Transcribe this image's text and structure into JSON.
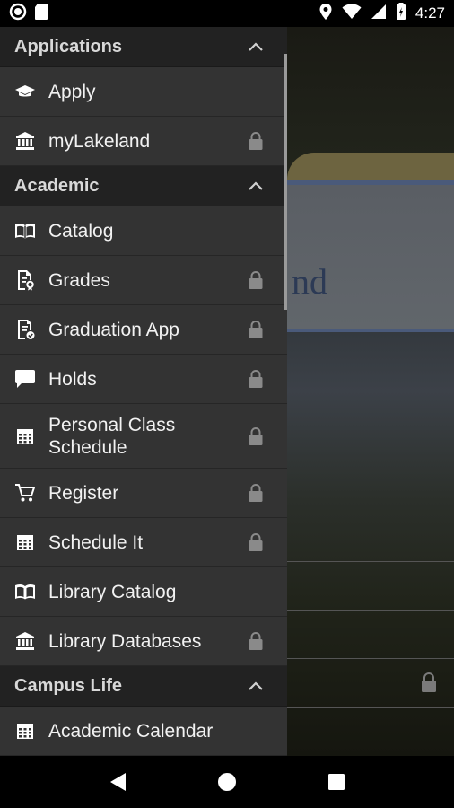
{
  "status_bar": {
    "time": "4:27",
    "icons": [
      "circle-notification-icon",
      "sd-card-icon",
      "location-icon",
      "wifi-icon",
      "signal-icon",
      "battery-icon"
    ]
  },
  "drawer": {
    "sections": [
      {
        "title": "Applications",
        "items": [
          {
            "label": "Apply",
            "icon": "graduation-cap-icon",
            "locked": false
          },
          {
            "label": "myLakeland",
            "icon": "bank-icon",
            "locked": true
          }
        ]
      },
      {
        "title": "Academic",
        "items": [
          {
            "label": "Catalog",
            "icon": "book-icon",
            "locked": false
          },
          {
            "label": "Grades",
            "icon": "grades-doc-icon",
            "locked": true
          },
          {
            "label": "Graduation App",
            "icon": "doc-check-icon",
            "locked": true
          },
          {
            "label": "Holds",
            "icon": "chat-bubble-icon",
            "locked": true
          },
          {
            "label": "Personal Class Schedule",
            "icon": "calendar-icon",
            "locked": true
          },
          {
            "label": "Register",
            "icon": "cart-icon",
            "locked": true
          },
          {
            "label": "Schedule It",
            "icon": "calendar-icon",
            "locked": true
          },
          {
            "label": "Library Catalog",
            "icon": "book-icon",
            "locked": false
          },
          {
            "label": "Library Databases",
            "icon": "bank-icon",
            "locked": true
          }
        ]
      },
      {
        "title": "Campus Life",
        "items": [
          {
            "label": "Academic Calendar",
            "icon": "calendar-icon",
            "locked": false
          }
        ]
      }
    ]
  },
  "background": {
    "sign_text": "nd"
  },
  "colors": {
    "drawer_bg": "#333333",
    "section_bg": "#222222",
    "text": "#f2f2f2",
    "lock": "#8a8a8a"
  }
}
